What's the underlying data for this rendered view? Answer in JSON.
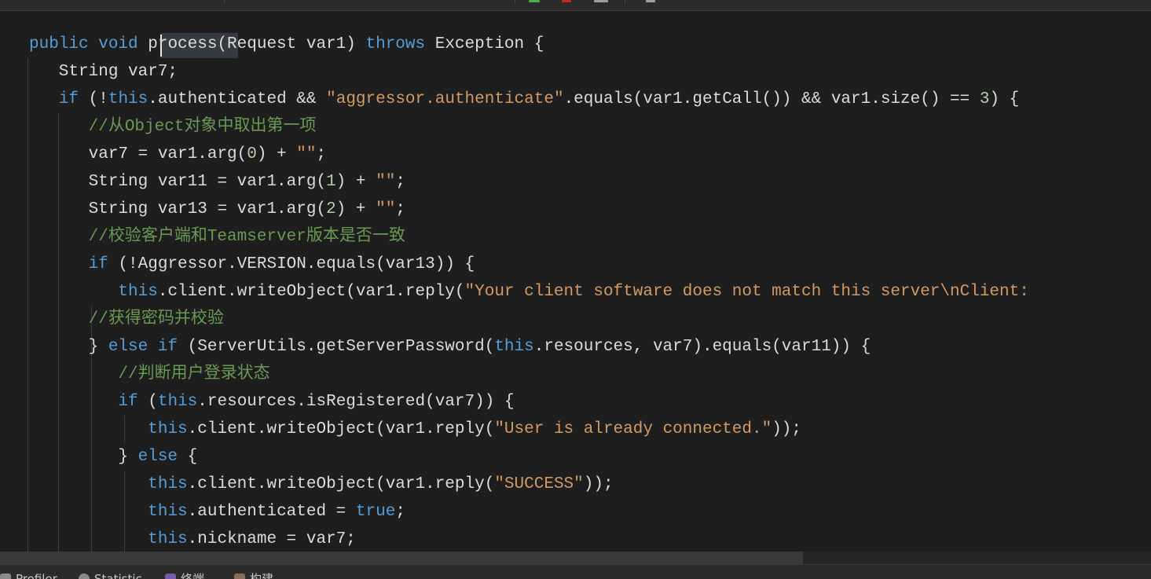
{
  "editor": {
    "lines": [
      [
        {
          "t": "public void ",
          "c": "kw"
        },
        {
          "t": "process(Request var1) "
        },
        {
          "t": "throws",
          "c": "kw"
        },
        {
          "t": " Exception {"
        }
      ],
      [
        {
          "t": "   String var7;"
        }
      ],
      [
        {
          "t": "   "
        },
        {
          "t": "if",
          "c": "kw"
        },
        {
          "t": " (!"
        },
        {
          "t": "this",
          "c": "kw"
        },
        {
          "t": ".authenticated && "
        },
        {
          "t": "\"aggressor.authenticate\"",
          "c": "str"
        },
        {
          "t": ".equals(var1.getCall()) && var1.size() == "
        },
        {
          "t": "3",
          "c": "num"
        },
        {
          "t": ") {"
        }
      ],
      [
        {
          "t": "      "
        },
        {
          "t": "//从Object对象中取出第一项",
          "c": "cm"
        }
      ],
      [
        {
          "t": "      var7 = var1.arg("
        },
        {
          "t": "0",
          "c": "num"
        },
        {
          "t": ") + "
        },
        {
          "t": "\"\"",
          "c": "str"
        },
        {
          "t": ";"
        }
      ],
      [
        {
          "t": "      String var11 = var1.arg("
        },
        {
          "t": "1",
          "c": "num"
        },
        {
          "t": ") + "
        },
        {
          "t": "\"\"",
          "c": "str"
        },
        {
          "t": ";"
        }
      ],
      [
        {
          "t": "      String var13 = var1.arg("
        },
        {
          "t": "2",
          "c": "num"
        },
        {
          "t": ") + "
        },
        {
          "t": "\"\"",
          "c": "str"
        },
        {
          "t": ";"
        }
      ],
      [
        {
          "t": "      "
        },
        {
          "t": "//校验客户端和Teamserver版本是否一致",
          "c": "cm"
        }
      ],
      [
        {
          "t": "      "
        },
        {
          "t": "if",
          "c": "kw"
        },
        {
          "t": " (!Aggressor.VERSION.equals(var13)) {"
        }
      ],
      [
        {
          "t": "         "
        },
        {
          "t": "this",
          "c": "kw"
        },
        {
          "t": ".client.writeObject(var1.reply("
        },
        {
          "t": "\"Your client software does not match this server\\nClient:",
          "c": "str"
        }
      ],
      [
        {
          "t": "      "
        },
        {
          "t": "//获得密码并校验",
          "c": "cm"
        }
      ],
      [
        {
          "t": "      } "
        },
        {
          "t": "else if",
          "c": "kw"
        },
        {
          "t": " (ServerUtils.getServerPassword("
        },
        {
          "t": "this",
          "c": "kw"
        },
        {
          "t": ".resources, var7).equals(var11)) {"
        }
      ],
      [
        {
          "t": "         "
        },
        {
          "t": "//判断用户登录状态",
          "c": "cm"
        }
      ],
      [
        {
          "t": "         "
        },
        {
          "t": "if",
          "c": "kw"
        },
        {
          "t": " ("
        },
        {
          "t": "this",
          "c": "kw"
        },
        {
          "t": ".resources.isRegistered(var7)) {"
        }
      ],
      [
        {
          "t": "            "
        },
        {
          "t": "this",
          "c": "kw"
        },
        {
          "t": ".client.writeObject(var1.reply("
        },
        {
          "t": "\"User is already connected.\"",
          "c": "str"
        },
        {
          "t": "));"
        }
      ],
      [
        {
          "t": "         } "
        },
        {
          "t": "else",
          "c": "kw"
        },
        {
          "t": " {"
        }
      ],
      [
        {
          "t": "            "
        },
        {
          "t": "this",
          "c": "kw"
        },
        {
          "t": ".client.writeObject(var1.reply("
        },
        {
          "t": "\"SUCCESS\"",
          "c": "str"
        },
        {
          "t": "));"
        }
      ],
      [
        {
          "t": "            "
        },
        {
          "t": "this",
          "c": "kw"
        },
        {
          "t": ".authenticated = "
        },
        {
          "t": "true",
          "c": "kw"
        },
        {
          "t": ";"
        }
      ],
      [
        {
          "t": "            "
        },
        {
          "t": "this",
          "c": "kw"
        },
        {
          "t": ".nickname = var7;"
        }
      ]
    ]
  },
  "bottom_toolbar": {
    "items": [
      {
        "label": "Profiler",
        "icon": "profiler-icon",
        "color": "#8a8a8a"
      },
      {
        "label": "Statistic",
        "icon": "statistic-icon",
        "color": "#8a8a8a"
      },
      {
        "label": "终端",
        "icon": "terminal-icon",
        "color": "#7a5aa8"
      },
      {
        "label": "构建",
        "icon": "build-icon",
        "color": "#8a6a5a"
      }
    ]
  },
  "colors": {
    "keyword": "#569cd6",
    "string": "#d19a66",
    "number": "#b5cea8",
    "comment": "#6a9955",
    "text": "#dcdcdc",
    "background": "#1e1e1e"
  }
}
